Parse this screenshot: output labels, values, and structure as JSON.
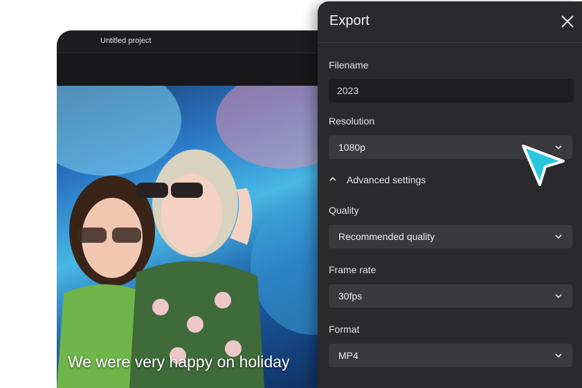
{
  "editor": {
    "project_title": "Untitled project",
    "caption": "We were very happy on holiday"
  },
  "export_panel": {
    "title": "Export",
    "filename_label": "Filename",
    "filename_value": "2023",
    "resolution_label": "Resolution",
    "resolution_value": "1080p",
    "advanced_label": "Advanced settings",
    "quality_label": "Quality",
    "quality_value": "Recommended quality",
    "frame_rate_label": "Frame rate",
    "frame_rate_value": "30fps",
    "format_label": "Format",
    "format_value": "MP4"
  },
  "icons": {
    "close": "close-icon",
    "dropdown": "chevron-down-icon",
    "advanced_toggle": "chevron-up-icon",
    "pointer": "cursor-arrow-icon"
  },
  "colors": {
    "panel_bg": "#2a2a2c",
    "select_bg": "#3a3a3d",
    "input_bg": "#1e1e20",
    "cursor_fill": "#29c6e0"
  }
}
